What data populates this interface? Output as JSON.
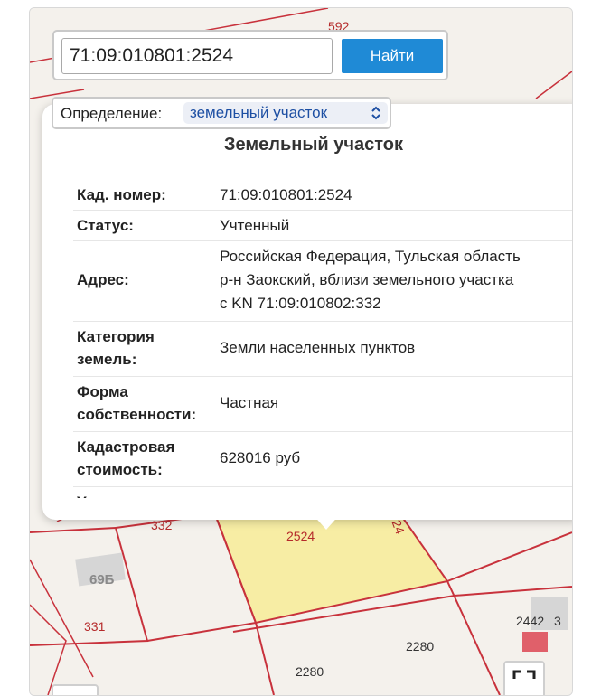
{
  "search": {
    "value": "71:09:010801:2524",
    "button_label": "Найти"
  },
  "definition": {
    "label": "Определение:",
    "selected": "земельный участок"
  },
  "popup": {
    "title": "Земельный участок",
    "rows": [
      {
        "label": "Кад. номер:",
        "value": "71:09:010801:2524"
      },
      {
        "label": "Статус:",
        "value": "Учтенный"
      },
      {
        "label": "Адрес:",
        "value": "Российская Федерация, Тульская область р-н Заокский, вблизи земельного участка с KN 71:09:010802:332"
      },
      {
        "label": "Категория земель:",
        "value": "Земли населенных пунктов"
      },
      {
        "label": "Форма собственности:",
        "value": "Частная"
      },
      {
        "label": "Кадастровая стоимость:",
        "value": "628016 руб"
      },
      {
        "label": "Уточненная",
        "value": ""
      }
    ],
    "address_lines": [
      "Российская Федерация, Тульская область",
      "р-н Заокский, вблизи земельного участка",
      "с KN 71:09:010802:332"
    ],
    "label_lines": {
      "category": [
        "Категория",
        "земель:"
      ],
      "ownership": [
        "Форма",
        "собственности:"
      ],
      "cost": [
        "Кадастровая",
        "стоимость:"
      ]
    }
  },
  "map": {
    "parcel_labels": [
      "332",
      "2524",
      "24",
      "69Б",
      "331",
      "2442",
      "3",
      "2280",
      "2280",
      "592"
    ],
    "colors": {
      "selected_parcel": "#f7eda4",
      "boundary": "#c8323c",
      "building": "#d6d6d6",
      "highlight_building": "#e0606a"
    }
  }
}
